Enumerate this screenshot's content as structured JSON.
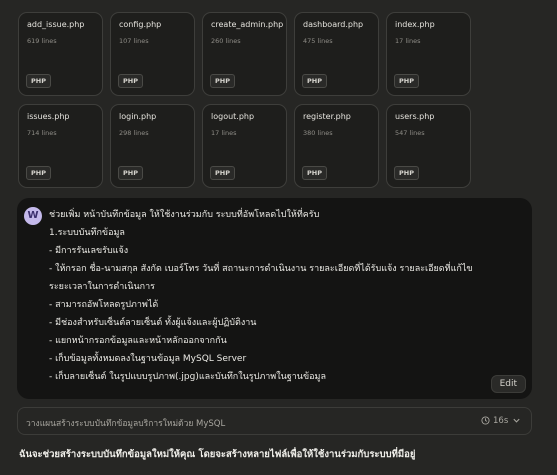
{
  "files": [
    {
      "name": "add_issue.php",
      "lines": "619 lines",
      "badge": "PHP"
    },
    {
      "name": "config.php",
      "lines": "107 lines",
      "badge": "PHP"
    },
    {
      "name": "create_admin.php",
      "lines": "260 lines",
      "badge": "PHP"
    },
    {
      "name": "dashboard.php",
      "lines": "475 lines",
      "badge": "PHP"
    },
    {
      "name": "index.php",
      "lines": "17 lines",
      "badge": "PHP"
    },
    {
      "name": "issues.php",
      "lines": "714 lines",
      "badge": "PHP"
    },
    {
      "name": "login.php",
      "lines": "298 lines",
      "badge": "PHP"
    },
    {
      "name": "logout.php",
      "lines": "17 lines",
      "badge": "PHP"
    },
    {
      "name": "register.php",
      "lines": "380 lines",
      "badge": "PHP"
    },
    {
      "name": "users.php",
      "lines": "547 lines",
      "badge": "PHP"
    }
  ],
  "message": {
    "avatar": "W",
    "lines": [
      "ช่วยเพิ่ม หน้าบันทึกข้อมูล ให้ใช้งานร่วมกับ ระบบที่อัพโหลดไปให้ที่ครับ",
      "1.ระบบบันทึกข้อมูล",
      "   - มีการรันเลขรับแจ้ง",
      "   - ให้กรอก ชื่อ-นามสกุล สังกัด เบอร์โทร วันที่ สถานะการดำเนินงาน รายละเอียดที่ได้รับแจ้ง รายละเอียดที่แก้ไข",
      "   ระยะเวลาในการดำเนินการ",
      "   - สามารถอัพโหลดรูปภาพได้",
      "   - มีช่องสำหรับเซ็นต์ลายเซ็นต์ ทั้งผู้แจ้งและผู้ปฏิบัติงาน",
      "   - แยกหน้ากรอกข้อมูลและหน้าหลักออกจากกัน",
      "   - เก็บข้อมูลทั้งหมดลงในฐานข้อมูล MySQL Server",
      "   - เก็บลายเซ็นต์ ในรูปแบบรูปภาพ(.jpg)และบันทึกในรูปภาพในฐานข้อมูล"
    ],
    "edit_label": "Edit"
  },
  "thinking": {
    "label": "วางแผนสร้างระบบบันทึกข้อมูลบริการใหม่ด้วย MySQL",
    "time": "16s"
  },
  "reply_text": "ฉันจะช่วยสร้างระบบบันทึกข้อมูลใหม่ให้คุณ โดยจะสร้างหลายไฟล์เพื่อให้ใช้งานร่วมกับระบบที่มีอยู่"
}
